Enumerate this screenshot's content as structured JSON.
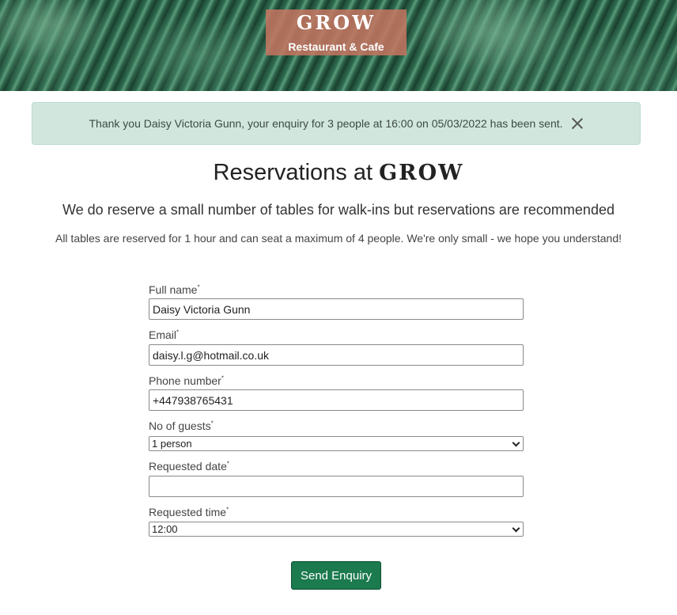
{
  "header": {
    "brand": "GROW",
    "tagline": "Restaurant & Cafe"
  },
  "alert": {
    "message": "Thank you Daisy Victoria Gunn, your enquiry for 3 people at 16:00 on 05/03/2022 has been sent."
  },
  "page": {
    "title_prefix": "Reservations at",
    "title_brand": "GROW",
    "subtitle": "We do reserve a small number of tables for walk-ins but reservations are recommended",
    "note": "All tables are reserved for 1 hour and can seat a maximum of 4 people. We're only small - we hope you understand!"
  },
  "form": {
    "required_mark": "*",
    "full_name": {
      "label": "Full name",
      "value": "Daisy Victoria Gunn"
    },
    "email": {
      "label": "Email",
      "value": "daisy.l.g@hotmail.co.uk"
    },
    "phone": {
      "label": "Phone number",
      "value": "+447938765431"
    },
    "guests": {
      "label": "No of guests",
      "selected": "1 person"
    },
    "date": {
      "label": "Requested date",
      "value": ""
    },
    "time": {
      "label": "Requested time",
      "selected": "12:00"
    },
    "submit_label": "Send Enquiry"
  },
  "colors": {
    "brand_badge": "#c77662",
    "alert_bg": "#d1e7dd",
    "button": "#1b7a4e"
  },
  "icons": {
    "alert_close": "close-icon",
    "select_arrow": "chevron-down-icon"
  }
}
